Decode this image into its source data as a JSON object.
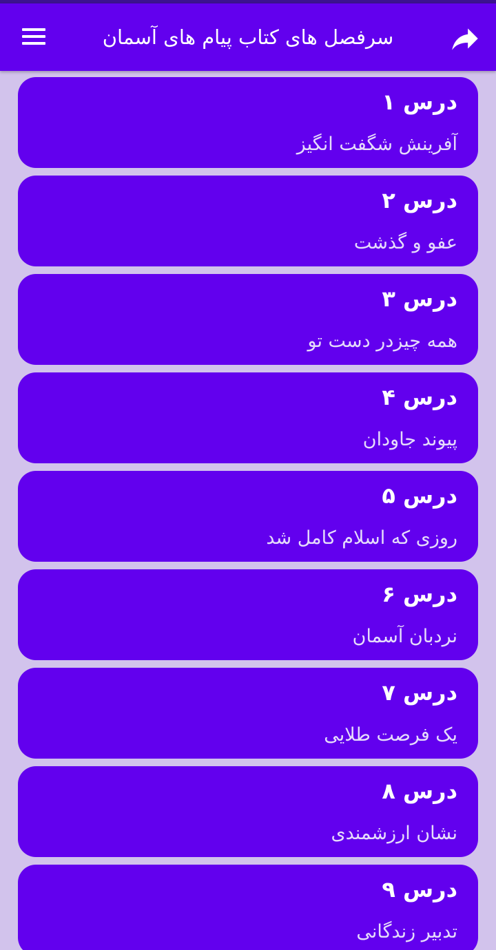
{
  "header": {
    "title": "سرفصل های کتاب پیام های آسمان",
    "menu_icon": "hamburger-menu-icon",
    "share_icon": "share-forward-icon"
  },
  "colors": {
    "primary": "#6200ee",
    "background": "#d2c3ec",
    "status_bar": "#3c1290"
  },
  "lessons": [
    {
      "title": "درس ۱",
      "subtitle": "آفرینش شگفت انگیز"
    },
    {
      "title": "درس ۲",
      "subtitle": "عفو و گذشت"
    },
    {
      "title": "درس ۳",
      "subtitle": "همه چیزدر دست تو"
    },
    {
      "title": "درس ۴",
      "subtitle": "پیوند جاودان"
    },
    {
      "title": "درس ۵",
      "subtitle": "روزی که اسلام کامل شد"
    },
    {
      "title": "درس ۶",
      "subtitle": "نردبان آسمان"
    },
    {
      "title": "درس ۷",
      "subtitle": "یک فرصت طلایی"
    },
    {
      "title": "درس ۸",
      "subtitle": "نشان ارزشمندی"
    },
    {
      "title": "درس ۹",
      "subtitle": "تدبیر زندگانی"
    }
  ]
}
